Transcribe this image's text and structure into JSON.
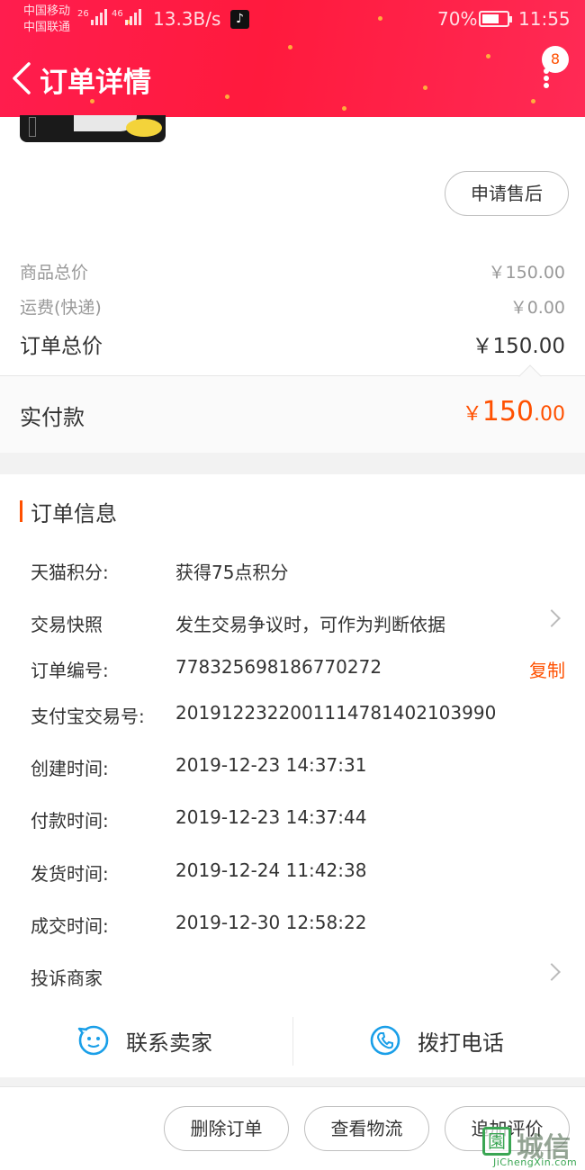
{
  "status_bar": {
    "carrier1": "中国移动",
    "carrier2": "中国联通",
    "net1": "26",
    "net2": "46",
    "speed": "13.3B/s",
    "battery": "70%",
    "battery_level": 0.7,
    "time": "11:55"
  },
  "header": {
    "title": "订单详情",
    "badge": "8",
    "colors": {
      "bg": "#ff1d4e",
      "accent": "#ff5000"
    }
  },
  "after_sale_button": "申请售后",
  "pricing": {
    "goods_label": "商品总价",
    "goods_value": "￥150.00",
    "shipping_label": "运费(快递)",
    "shipping_value": "￥0.00",
    "total_label": "订单总价",
    "total_value": "￥150.00",
    "paid_label": "实付款",
    "paid_symbol": "￥",
    "paid_int": "150",
    "paid_dec": ".00"
  },
  "order_info": {
    "title": "订单信息",
    "points_label": "天猫积分:",
    "points_value": "获得75点积分",
    "snapshot_label": "交易快照",
    "snapshot_value": "发生交易争议时，可作为判断依据",
    "order_no_label": "订单编号:",
    "order_no_value": "778325698186770272",
    "copy_label": "复制",
    "alipay_label": "支付宝交易号:",
    "alipay_value": "2019122322001114781402103990",
    "created_label": "创建时间:",
    "created_value": "2019-12-23 14:37:31",
    "paid_label": "付款时间:",
    "paid_value": "2019-12-23 14:37:44",
    "shipped_label": "发货时间:",
    "shipped_value": "2019-12-24 11:42:38",
    "deal_label": "成交时间:",
    "deal_value": "2019-12-30 12:58:22",
    "complain_label": "投诉商家"
  },
  "contact": {
    "seller": "联系卖家",
    "phone": "拨打电话"
  },
  "bottom": {
    "delete": "删除订单",
    "logistics": "查看物流",
    "review": "追加评价"
  },
  "watermark": {
    "cn": "城信",
    "en": "JiChengXin.com"
  }
}
